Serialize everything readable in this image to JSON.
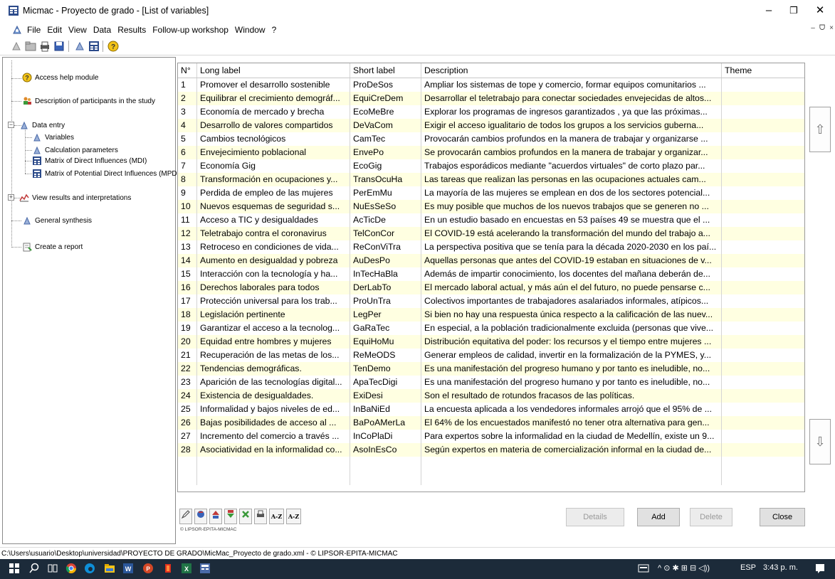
{
  "window": {
    "app": "Micmac",
    "title": "Micmac  -  Proyecto de grado - [List of variables]",
    "controls": {
      "minimize": "–",
      "restore": "❐",
      "close": "✕"
    }
  },
  "menubar": {
    "items": [
      "File",
      "Edit",
      "View",
      "Data",
      "Results",
      "Follow-up workshop",
      "Window",
      "?"
    ],
    "mdi_controls": [
      "–",
      "ᗜ",
      "×"
    ]
  },
  "toolbar": {
    "icons": [
      "new-icon",
      "open-icon",
      "print-icon",
      "save-icon",
      "variables-icon",
      "matrix-icon",
      "help-icon"
    ]
  },
  "tree": {
    "items": [
      {
        "label": "Access help module",
        "icon": "help-icon"
      },
      {
        "label": "Description of participants in the study",
        "icon": "participants-icon"
      },
      {
        "label": "Data entry",
        "icon": "data-entry-icon"
      },
      {
        "label": "Variables",
        "icon": "variables-icon"
      },
      {
        "label": "Calculation parameters",
        "icon": "parameters-icon"
      },
      {
        "label": "Matrix of Direct Influences (MDI)",
        "icon": "matrix-icon"
      },
      {
        "label": "Matrix of Potential Direct Influences (MPDI)",
        "icon": "matrix-icon"
      },
      {
        "label": "View results and interpretations",
        "icon": "chart-icon"
      },
      {
        "label": "General synthesis",
        "icon": "synthesis-icon"
      },
      {
        "label": "Create a report",
        "icon": "report-icon"
      }
    ],
    "expanders": {
      "data_entry": "−",
      "view_results": "+"
    }
  },
  "table": {
    "headers": [
      "N°",
      "Long label",
      "Short label",
      "Description",
      "Theme"
    ],
    "rows": [
      [
        "1",
        "Promover el desarrollo sostenible",
        "ProDeSos",
        "Ampliar los sistemas de tope y comercio, formar equipos comunitarios ...",
        ""
      ],
      [
        "2",
        "Equilibrar el crecimiento demográf...",
        "EquiCreDem",
        "Desarrollar el teletrabajo para conectar sociedades envejecidas de altos...",
        ""
      ],
      [
        "3",
        "Economía de mercado y brecha",
        "EcoMeBre",
        "Explorar  los programas de ingresos garantizados , ya que las próximas...",
        ""
      ],
      [
        "4",
        "Desarrollo de valores compartidos",
        "DeVaCom",
        "Exigir el acceso igualitario de todos los grupos a los servicios guberna...",
        ""
      ],
      [
        "5",
        "Cambios tecnológicos",
        "CamTec",
        "Provocarán cambios profundos en la manera de trabajar y organizarse ...",
        ""
      ],
      [
        "6",
        "Envejecimiento poblacional",
        "EnvePo",
        "Se provocarán cambios profundos en la manera de trabajar y organizar...",
        ""
      ],
      [
        "7",
        "Economía Gig",
        "EcoGig",
        "Trabajos esporádicos mediante \"acuerdos virtuales\" de corto plazo par...",
        ""
      ],
      [
        "8",
        "Transformación en ocupaciones y...",
        "TransOcuHa",
        "Las tareas que realizan las personas en las ocupaciones actuales cam...",
        ""
      ],
      [
        "9",
        "Perdida de empleo de las mujeres",
        "PerEmMu",
        "La mayoría de las mujeres se emplean en dos de los sectores potencial...",
        ""
      ],
      [
        "10",
        "Nuevos esquemas de seguridad s...",
        "NuEsSeSo",
        "Es muy posible que muchos de los nuevos trabajos que se generen no ...",
        ""
      ],
      [
        "11",
        "Acceso a TIC y desigualdades",
        "AcTicDe",
        "En un estudio basado en encuestas en 53 países 49 se muestra que el ...",
        ""
      ],
      [
        "12",
        "Teletrabajo contra el coronavirus",
        "TelConCor",
        "El COVID-19 está acelerando la transformación del mundo del trabajo a...",
        ""
      ],
      [
        "13",
        "Retroceso en condiciones de vida...",
        "ReConViTra",
        "La perspectiva positiva que se tenía para la década 2020-2030 en los paí...",
        ""
      ],
      [
        "14",
        "Aumento en desigualdad y pobreza",
        "AuDesPo",
        "Aquellas personas que antes del COVID-19 estaban en situaciones de v...",
        ""
      ],
      [
        "15",
        "Interacción con la tecnología y ha...",
        "InTecHaBla",
        "Además de impartir conocimiento, los docentes del mañana deberán de...",
        ""
      ],
      [
        "16",
        "Derechos laborales para todos",
        "DerLabTo",
        "El mercado laboral actual, y más aún el del futuro, no puede pensarse c...",
        ""
      ],
      [
        "17",
        "Protección universal para los trab...",
        "ProUnTra",
        "Colectivos importantes de trabajadores asalariados informales, atípicos...",
        ""
      ],
      [
        "18",
        "Legislación pertinente",
        "LegPer",
        "Si bien no hay una respuesta única respecto a la calificación de las nuev...",
        ""
      ],
      [
        "19",
        "Garantizar el acceso a la tecnolog...",
        "GaRaTec",
        "En especial, a la población tradicionalmente excluida (personas que vive...",
        ""
      ],
      [
        "20",
        "Equidad entre hombres y mujeres",
        "EquiHoMu",
        "Distribución equitativa del poder: los recursos y el tiempo entre mujeres ...",
        ""
      ],
      [
        "21",
        "Recuperación de las metas de los...",
        "ReMeODS",
        "Generar empleos de calidad, invertir en la formalización de la PYMES, y...",
        ""
      ],
      [
        "22",
        "Tendencias demográficas.",
        "TenDemo",
        "Es una manifestación del progreso humano y por tanto es ineludible, no...",
        ""
      ],
      [
        "23",
        "Aparición de las tecnologías digital...",
        "ApaTecDigi",
        "Es una manifestación del progreso humano y por tanto es ineludible, no...",
        ""
      ],
      [
        "24",
        "Existencia de desigualdades.",
        "ExiDesi",
        "Son el resultado de rotundos fracasos de las políticas.",
        ""
      ],
      [
        "25",
        "Informalidad y bajos niveles de ed...",
        "InBaNiEd",
        "La encuesta aplicada a los vendedores informales arrojó que el 95% de ...",
        ""
      ],
      [
        "26",
        "Bajas posibilidades de acceso al ...",
        "BaPoAMerLa",
        "El 64% de los encuestados manifestó no tener otra alternativa para gen...",
        ""
      ],
      [
        "27",
        "Incremento del comercio a través ...",
        "InCoPlaDi",
        "Para expertos sobre la informalidad en la ciudad de Medellín, existe un 9...",
        ""
      ],
      [
        "28",
        "Asociatividad en la informalidad co...",
        "AsoInEsCo",
        "Según expertos en materia de comercialización informal en la ciudad de...",
        ""
      ]
    ]
  },
  "scroll": {
    "left": "‹",
    "right": "›",
    "up": "⇧",
    "down": "⇩"
  },
  "bottom_tools": {
    "sort_asc": "A-Z",
    "sort_desc": "A-Z",
    "copyright": "© LIPSOR-EPITA-MICMAC"
  },
  "buttons": {
    "details": "Details",
    "add": "Add",
    "delete": "Delete",
    "close": "Close"
  },
  "statusbar": {
    "text": "C:\\Users\\usuario\\Desktop\\universidad\\PROYECTO DE GRADO\\MicMac_Proyecto de grado.xml  - © LIPSOR-EPITA-MICMAC"
  },
  "taskbar": {
    "language": "ESP",
    "time": "3:43 p. m.",
    "tray_symbols": "^  ⊙  ✱  ⊞  ⊟  ◁))"
  },
  "colors": {
    "row_highlight": "#ffffe1",
    "taskbar": "#1c2b3a"
  }
}
